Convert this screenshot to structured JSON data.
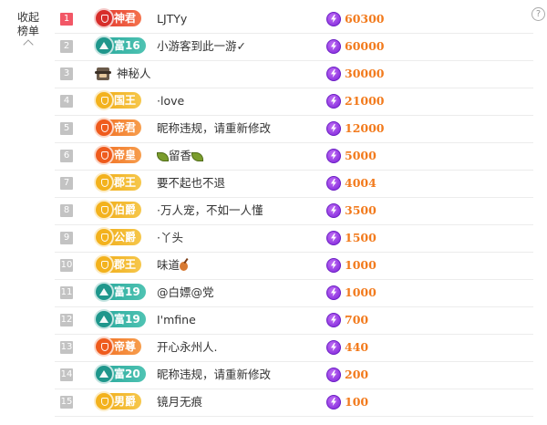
{
  "sidebar": {
    "collapse_label": "收起榜单"
  },
  "colors": {
    "score": "#f27a1c",
    "rank_top": "#f25766",
    "rank_default": "#c3c3c3"
  },
  "rows": [
    {
      "rank": "1",
      "badge": "神君",
      "badge_color": "red",
      "name": "LJTYy",
      "score": "60300"
    },
    {
      "rank": "2",
      "badge": "富16",
      "badge_color": "teal",
      "name": "小游客到此一游✓",
      "score": "60000"
    },
    {
      "rank": "3",
      "badge": "",
      "badge_color": "none",
      "name": "神秘人",
      "score": "30000"
    },
    {
      "rank": "4",
      "badge": "国王",
      "badge_color": "gold",
      "name": "·love",
      "score": "21000"
    },
    {
      "rank": "5",
      "badge": "帝君",
      "badge_color": "orange",
      "name": "昵称违规，请重新修改",
      "score": "12000"
    },
    {
      "rank": "6",
      "badge": "帝皇",
      "badge_color": "orange",
      "name": "留香",
      "score": "5000"
    },
    {
      "rank": "7",
      "badge": "郡王",
      "badge_color": "gold",
      "name": "要不起也不退",
      "score": "4004"
    },
    {
      "rank": "8",
      "badge": "伯爵",
      "badge_color": "gold",
      "name": "·万人宠，不如一人懂",
      "score": "3500"
    },
    {
      "rank": "9",
      "badge": "公爵",
      "badge_color": "gold",
      "name": "·丫头",
      "score": "1500"
    },
    {
      "rank": "10",
      "badge": "郡王",
      "badge_color": "gold",
      "name": "味道",
      "score": "1000"
    },
    {
      "rank": "11",
      "badge": "富19",
      "badge_color": "teal",
      "name": "@白嫖@党",
      "score": "1000"
    },
    {
      "rank": "12",
      "badge": "富19",
      "badge_color": "teal",
      "name": "I'mfine",
      "score": "700"
    },
    {
      "rank": "13",
      "badge": "帝尊",
      "badge_color": "orange",
      "name": "开心永州人.",
      "score": "440"
    },
    {
      "rank": "14",
      "badge": "富20",
      "badge_color": "teal",
      "name": "昵称违规，请重新修改",
      "score": "200"
    },
    {
      "rank": "15",
      "badge": "男爵",
      "badge_color": "gold",
      "name": "镜月无痕",
      "score": "100"
    }
  ],
  "icons": {
    "help": "help-icon",
    "collapse": "chevron-up-icon",
    "score": "lightning-coin-icon",
    "anonymous": "spy-avatar-icon"
  }
}
